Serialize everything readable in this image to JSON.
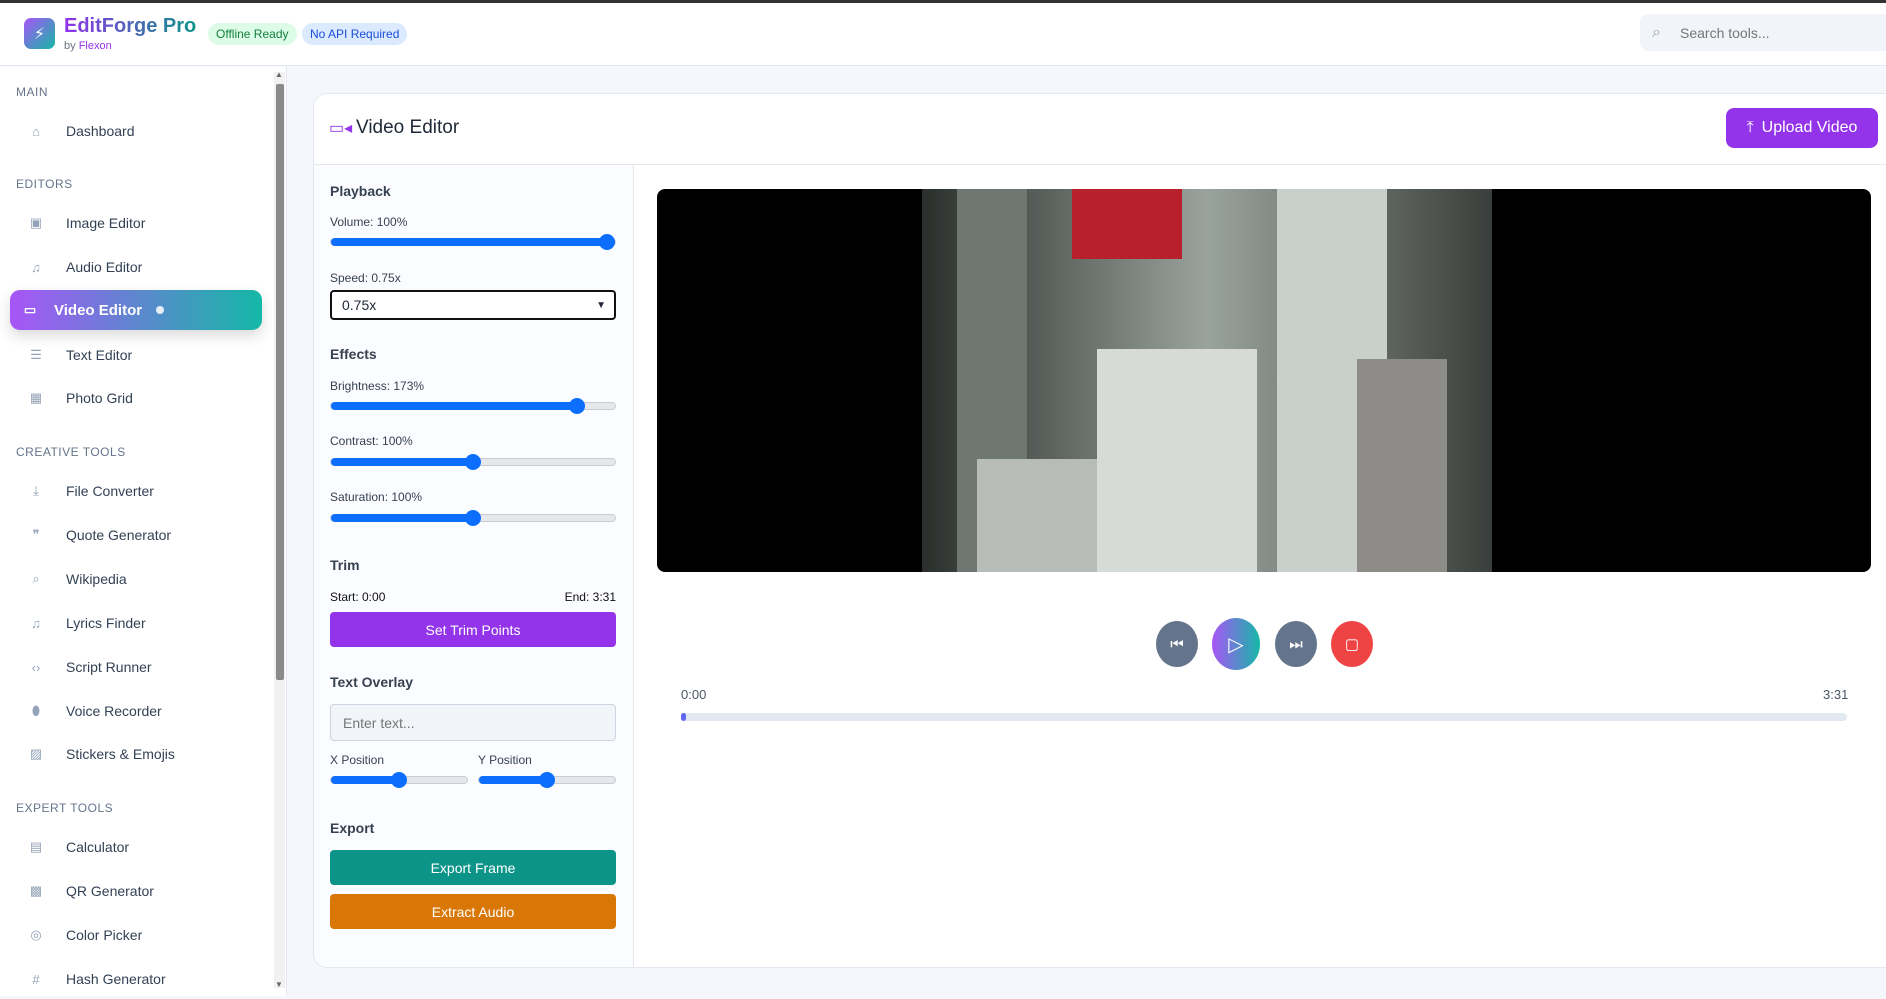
{
  "header": {
    "app_name": "EditForge Pro",
    "by_prefix": "by",
    "by_name": "Flexon",
    "badges": [
      "Offline Ready",
      "No API Required"
    ],
    "search_placeholder": "Search tools..."
  },
  "sidebar": {
    "sections": [
      "MAIN",
      "EDITORS",
      "CREATIVE TOOLS",
      "EXPERT TOOLS"
    ],
    "items": [
      {
        "label": "Dashboard",
        "icon": "home-icon"
      },
      {
        "label": "Image Editor",
        "icon": "image-icon"
      },
      {
        "label": "Audio Editor",
        "icon": "music-icon"
      },
      {
        "label": "Video Editor",
        "icon": "video-icon"
      },
      {
        "label": "Text Editor",
        "icon": "file-text-icon"
      },
      {
        "label": "Photo Grid",
        "icon": "grid-icon"
      },
      {
        "label": "File Converter",
        "icon": "download-icon"
      },
      {
        "label": "Quote Generator",
        "icon": "quote-icon"
      },
      {
        "label": "Wikipedia",
        "icon": "search-icon"
      },
      {
        "label": "Lyrics Finder",
        "icon": "music-icon"
      },
      {
        "label": "Script Runner",
        "icon": "code-icon"
      },
      {
        "label": "Voice Recorder",
        "icon": "mic-icon"
      },
      {
        "label": "Stickers & Emojis",
        "icon": "sticker-icon"
      },
      {
        "label": "Calculator",
        "icon": "calculator-icon"
      },
      {
        "label": "QR Generator",
        "icon": "qr-icon"
      },
      {
        "label": "Color Picker",
        "icon": "palette-icon"
      },
      {
        "label": "Hash Generator",
        "icon": "hash-icon"
      }
    ]
  },
  "editor": {
    "title": "Video Editor",
    "upload_label": "Upload Video",
    "playback": {
      "heading": "Playback",
      "volume_label": "Volume: 100%",
      "volume": 100,
      "volume_max": 100,
      "speed_label": "Speed: 0.75x",
      "speed_value": "0.75x"
    },
    "effects": {
      "heading": "Effects",
      "brightness_label": "Brightness: 173%",
      "brightness": 173,
      "contrast_label": "Contrast: 100%",
      "contrast": 100,
      "saturation_label": "Saturation: 100%",
      "saturation": 100,
      "max": 200
    },
    "trim": {
      "heading": "Trim",
      "start": "Start: 0:00",
      "end": "End: 3:31",
      "button": "Set Trim Points"
    },
    "overlay": {
      "heading": "Text Overlay",
      "placeholder": "Enter text...",
      "x_label": "X Position",
      "y_label": "Y Position",
      "x": 50,
      "y": 50,
      "max": 100
    },
    "export": {
      "heading": "Export",
      "frame_button": "Export Frame",
      "audio_button": "Extract Audio"
    },
    "player": {
      "current": "0:00",
      "duration": "3:31",
      "progress": 0.002
    }
  },
  "colors": {
    "accent": "#9333ea",
    "teal": "#0d9488",
    "orange": "#d97706",
    "stop": "#ef4444",
    "ctrl": "#64748b"
  }
}
